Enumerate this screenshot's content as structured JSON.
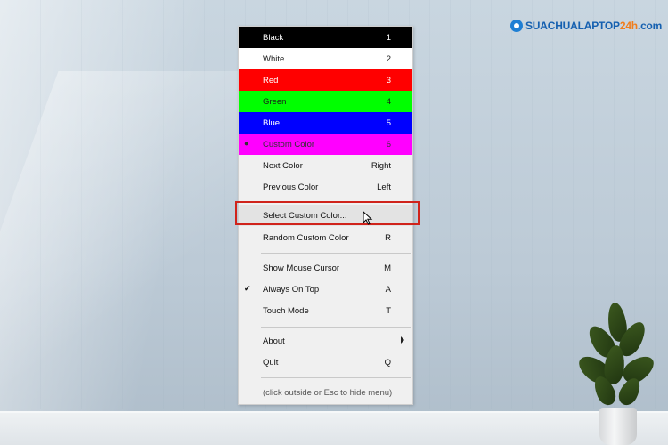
{
  "brand": {
    "logo_main": "SUACHUALAPTOP",
    "logo_accent": "24h",
    "logo_suffix": ".com"
  },
  "menu": {
    "colors": [
      {
        "label": "Black",
        "key": "1",
        "bg": "#000000",
        "fg": "#ffffff"
      },
      {
        "label": "White",
        "key": "2",
        "bg": "#ffffff",
        "fg": "#222222"
      },
      {
        "label": "Red",
        "key": "3",
        "bg": "#ff0000",
        "fg": "#ffffff"
      },
      {
        "label": "Green",
        "key": "4",
        "bg": "#00ff00",
        "fg": "#1b1b1b"
      },
      {
        "label": "Blue",
        "key": "5",
        "bg": "#0000ff",
        "fg": "#ffffff"
      },
      {
        "label": "Custom Color",
        "key": "6",
        "bg": "#ff00ff",
        "fg": "#333333",
        "selected_mark": "●"
      }
    ],
    "next_color": {
      "label": "Next Color",
      "key": "Right"
    },
    "previous_color": {
      "label": "Previous Color",
      "key": "Left"
    },
    "select_custom_color": {
      "label": "Select Custom Color..."
    },
    "random_custom_color": {
      "label": "Random Custom Color",
      "key": "R"
    },
    "show_mouse_cursor": {
      "label": "Show Mouse Cursor",
      "key": "M"
    },
    "always_on_top": {
      "label": "Always On Top",
      "key": "A",
      "check_mark": "✔"
    },
    "touch_mode": {
      "label": "Touch Mode",
      "key": "T"
    },
    "about": {
      "label": "About"
    },
    "quit": {
      "label": "Quit",
      "key": "Q"
    },
    "hint": "(click outside or Esc to hide menu)"
  },
  "annotation_color": "#d0231b"
}
